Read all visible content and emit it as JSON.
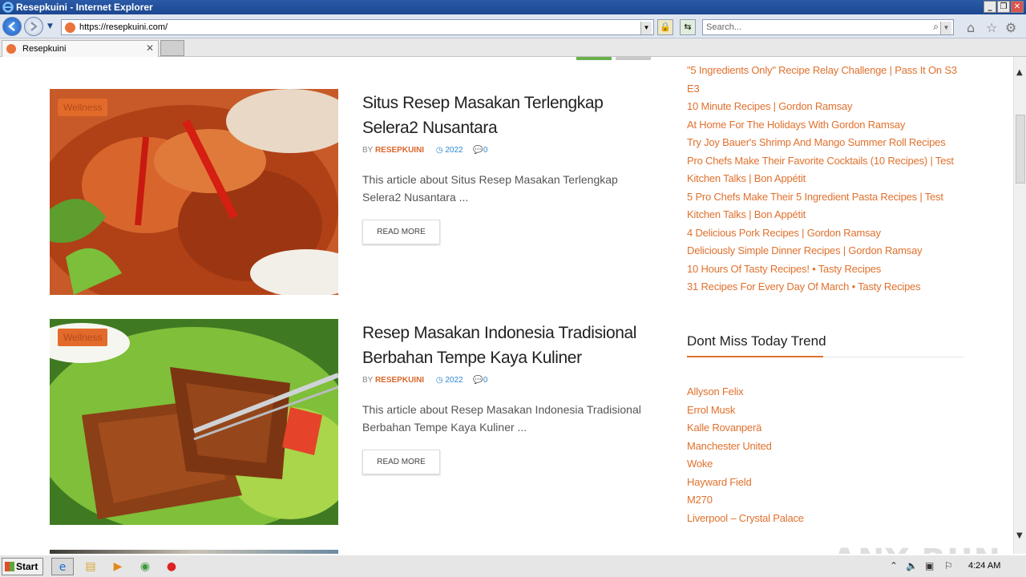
{
  "window": {
    "title": "Resepkuini - Internet Explorer"
  },
  "address_bar": {
    "url": "https://resepkuini.com/"
  },
  "search": {
    "placeholder": "Search..."
  },
  "tab": {
    "label": "Resepkuini"
  },
  "posts": [
    {
      "category": "Wellness",
      "title": "Situs Resep Masakan Terlengkap Selera2 Nusantara",
      "by": "BY",
      "author": "RESEPKUINI",
      "year": "2022",
      "comments": "0",
      "excerpt": "This article about Situs Resep Masakan Terlengkap Selera2 Nusantara ...",
      "read_more": "READ MORE"
    },
    {
      "category": "Wellness",
      "title": "Resep Masakan Indonesia Tradisional Berbahan Tempe Kaya Kuliner",
      "by": "BY",
      "author": "RESEPKUINI",
      "year": "2022",
      "comments": "0",
      "excerpt": "This article about Resep Masakan Indonesia Tradisional Berbahan Tempe Kaya Kuliner ...",
      "read_more": "READ MORE"
    }
  ],
  "sidebar": {
    "recent_links": [
      "\"5 Ingredients Only\" Recipe Relay Challenge | Pass It On S3 E3",
      "10 Minute Recipes | Gordon Ramsay",
      "At Home For The Holidays With Gordon Ramsay",
      "Try Joy Bauer's Shrimp And Mango Summer Roll Recipes",
      "Pro Chefs Make Their Favorite Cocktails (10 Recipes) | Test Kitchen Talks | Bon Appétit",
      "5 Pro Chefs Make Their 5 Ingredient Pasta Recipes | Test Kitchen Talks | Bon Appétit",
      "4 Delicious Pork Recipes | Gordon Ramsay",
      "Deliciously Simple Dinner Recipes | Gordon Ramsay",
      "10 Hours Of Tasty Recipes! • Tasty Recipes",
      "31 Recipes For Every Day Of March • Tasty Recipes"
    ],
    "trend_title": "Dont Miss Today Trend",
    "trend_links": [
      "Allyson Felix",
      "Errol Musk",
      "Kalle Rovanperä",
      "Manchester United",
      "Woke",
      "Hayward Field",
      "M270",
      "Liverpool – Crystal Palace"
    ]
  },
  "watermark": "ANY RUN",
  "taskbar": {
    "start_label": "Start",
    "clock": "4:24 AM"
  },
  "colors": {
    "accent": "#e0712e",
    "badge": "#e26b2b",
    "meta_blue": "#2a87d0"
  }
}
